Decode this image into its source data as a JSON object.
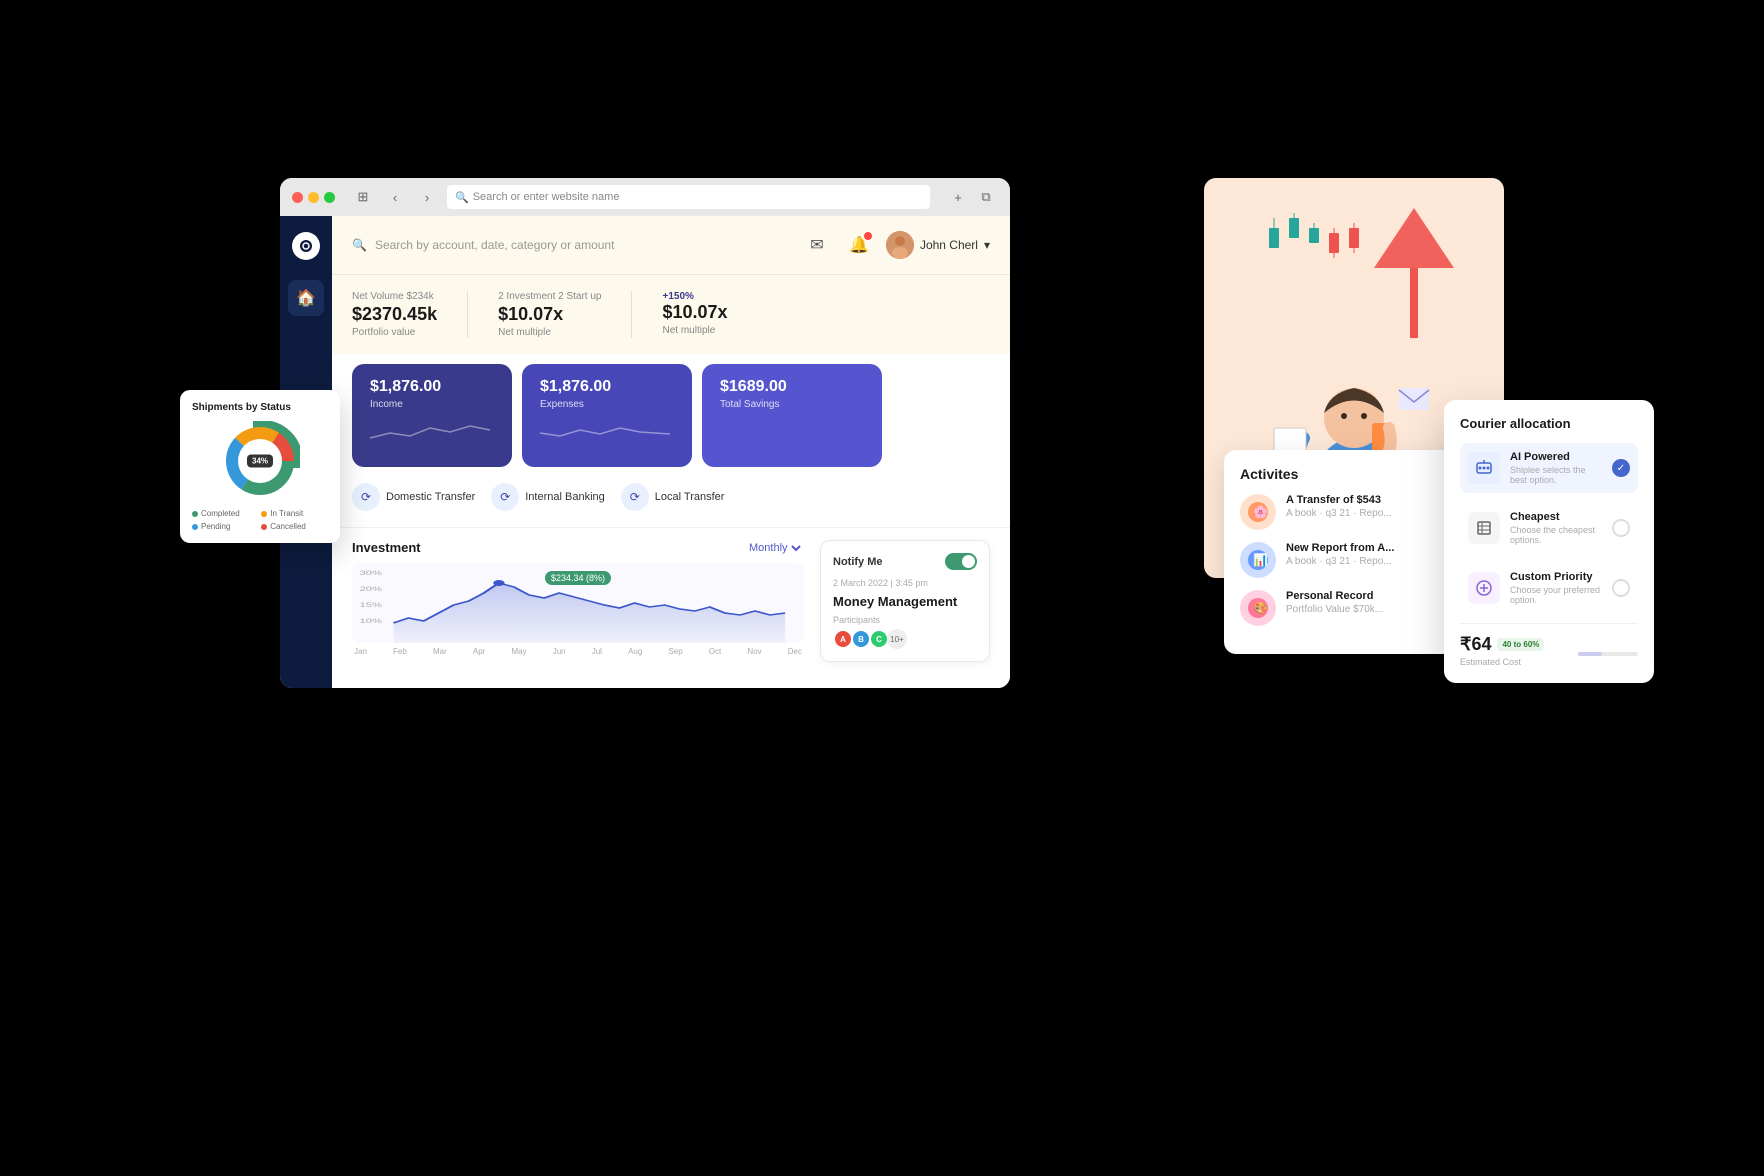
{
  "browser": {
    "address_placeholder": "Search or enter website name"
  },
  "header": {
    "search_placeholder": "Search by account, date, category or amount",
    "user_name": "John Cherl",
    "user_chevron": "▾"
  },
  "stats": {
    "net_volume_label": "Net Volume $234k",
    "net_volume_value": "$2370.45k",
    "net_volume_sub": "Portfolio value",
    "investment_label": "2 Investment 2 Start up",
    "investment_value": "$10.07x",
    "investment_sub": "Net multiple",
    "change_label": "+150%",
    "change_value": "$10.07x",
    "change_sub": "Net multiple"
  },
  "cards": {
    "income_amount": "$1,876.00",
    "income_label": "Income",
    "expense_amount": "$1,876.00",
    "expense_label": "Expenses",
    "savings_amount": "$1689.00",
    "savings_label": "Total Savings"
  },
  "transfers": {
    "domestic": "Domestic Transfer",
    "internal": "Internal Banking",
    "local": "Local Transfer"
  },
  "investment": {
    "title": "Investment",
    "monthly": "Monthly ▾",
    "chart_badge": "$234.34 (8%)",
    "months": [
      "Jan",
      "Feb",
      "Mar",
      "Apr",
      "May",
      "Jun",
      "Jul",
      "Aug",
      "Sep",
      "Oct",
      "Nov",
      "Dec"
    ]
  },
  "notify": {
    "label": "Notify Me",
    "date": "2 March 2022 | 3:45 pm",
    "title": "Money Management",
    "participants_label": "Participants",
    "more_count": "10+"
  },
  "activities": {
    "title": "Activites",
    "items": [
      {
        "title": "A Transfer of $543",
        "sub": "A book · q3 21 · Repo..."
      },
      {
        "title": "New Report from A...",
        "sub": "A book · q3 21 · Repo..."
      },
      {
        "title": "Personal Record",
        "sub": "Portfolio Value $70k..."
      }
    ]
  },
  "shipments": {
    "title": "Shipments by Status",
    "percentage": "34%",
    "legend": [
      {
        "label": "Completed",
        "color": "#3d9970"
      },
      {
        "label": "In Transit",
        "color": "#f39c12"
      },
      {
        "label": "Pending",
        "color": "#3498db"
      },
      {
        "label": "Cancelled",
        "color": "#e74c3c"
      }
    ]
  },
  "courier": {
    "title": "Courier allocation",
    "options": [
      {
        "id": "ai",
        "title": "AI Powered",
        "sub": "Shiplee selects the best option.",
        "selected": true
      },
      {
        "id": "cheapest",
        "title": "Cheapest",
        "sub": "Choose the cheapest options.",
        "selected": false
      },
      {
        "id": "custom",
        "title": "Custom Priority",
        "sub": "Choose your preferred option.",
        "selected": false
      }
    ],
    "cost_label": "Estimated Cost",
    "cost_amount": "₹64",
    "cost_badge": "40 to 60%"
  }
}
